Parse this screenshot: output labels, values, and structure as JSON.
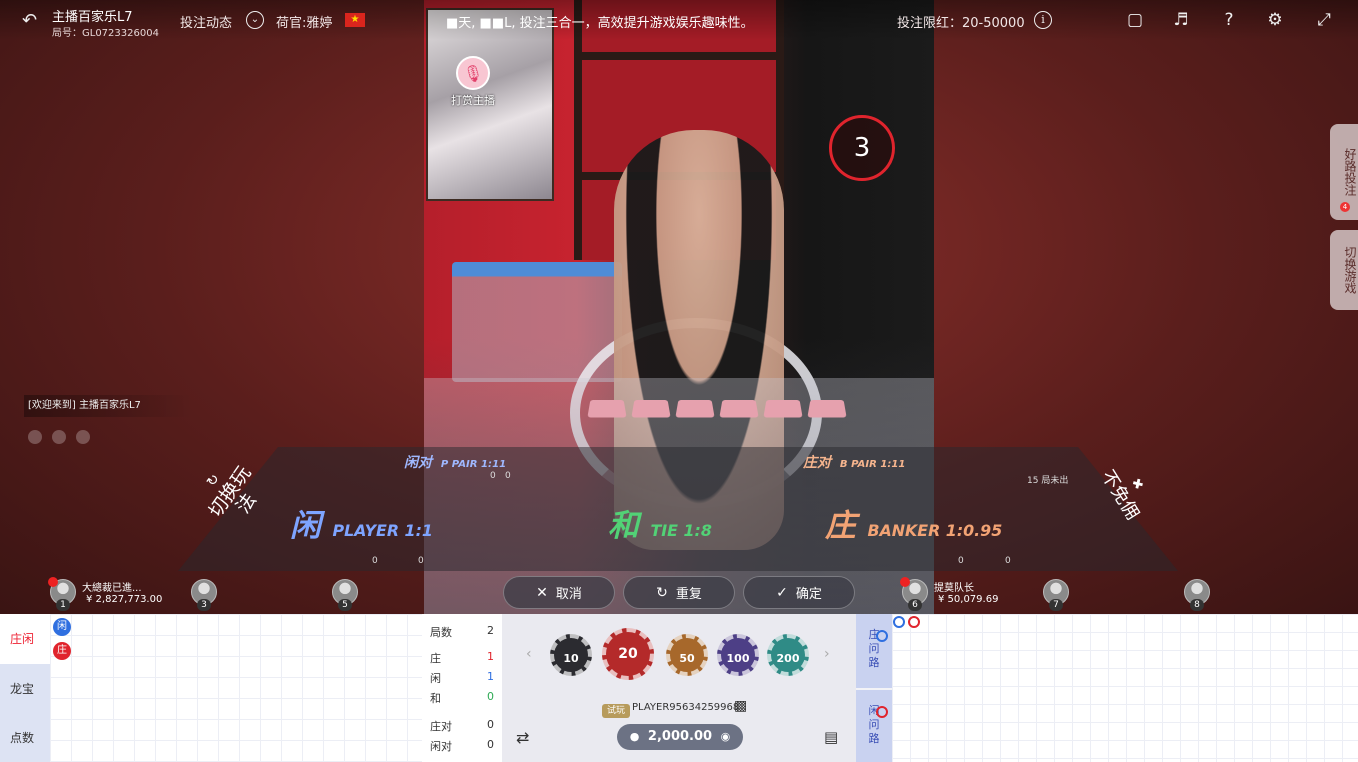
{
  "topbar": {
    "room_title": "主播百家乐L7",
    "round_id": "局号：GL0723326004",
    "bet_activity": "投注动态",
    "dealer_label": "荷官:雅婷",
    "marquee": "■天, ■■L, 投注三合一，高效提升游戏娱乐趣味性。",
    "bet_limit": "投注限红：20-50000",
    "icons": [
      "back-icon",
      "chevron-down-icon",
      "flag-icon",
      "info-icon",
      "camera-icon",
      "volume-icon",
      "help-icon",
      "settings-icon",
      "fullscreen-icon"
    ]
  },
  "video": {
    "tip_label": "打赏主播",
    "countdown": "3"
  },
  "side_tabs": {
    "good_road": "好路投注",
    "good_road_badge": "4",
    "switch_game": "切换游戏"
  },
  "chat": {
    "welcome": "[欢迎来到] 主播百家乐L7"
  },
  "table": {
    "switch_mode": "切换玩法",
    "no_commission": "不免佣",
    "p_pair_cn": "闲对",
    "p_pair_en": "P PAIR 1:11",
    "b_pair_cn": "庄对",
    "b_pair_en": "B PAIR 1:11",
    "player_cn": "闲",
    "player_en": "PLAYER 1:1",
    "tie_cn": "和",
    "tie_en": "TIE 1:8",
    "banker_cn": "庄",
    "banker_en": "BANKER 1:0.95",
    "zero": "0",
    "banker_side_note": "15 局未出"
  },
  "seats": [
    {
      "num": "1",
      "name": "大總裁已進...",
      "balance": "¥ 2,827,773.00"
    },
    {
      "num": "3",
      "name": "",
      "balance": ""
    },
    {
      "num": "5",
      "name": "",
      "balance": ""
    },
    {
      "num": "6",
      "name": "提莫队长",
      "balance": "¥ 50,079.69"
    },
    {
      "num": "7",
      "name": "",
      "balance": ""
    },
    {
      "num": "8",
      "name": "",
      "balance": ""
    }
  ],
  "actions": {
    "cancel": "取消",
    "repeat": "重复",
    "confirm": "确定"
  },
  "roads": {
    "tabs": [
      "庄闲",
      "龙宝",
      "点数"
    ],
    "bead_player": "闲",
    "bead_banker": "庄"
  },
  "stats": {
    "rounds_label": "局数",
    "rounds": "2",
    "banker_label": "庄",
    "banker": "1",
    "player_label": "闲",
    "player": "1",
    "tie_label": "和",
    "tie": "0",
    "bpair_label": "庄对",
    "bpair": "0",
    "ppair_label": "闲对",
    "ppair": "0"
  },
  "chips": {
    "values": [
      "10",
      "20",
      "50",
      "100",
      "200"
    ],
    "selected": "20",
    "colors": [
      "#2b2b30",
      "#b42a2a",
      "#a7682b",
      "#4d3f86",
      "#2f8b86"
    ]
  },
  "player": {
    "trial": "试玩",
    "id": "PLAYER95634259968",
    "balance": "2,000.00"
  },
  "ask": {
    "banker": "庄问路",
    "player": "闲问路"
  },
  "colors": {
    "player_blue": "#2f6fe0",
    "banker_red": "#e0242d",
    "tie_green": "#52d276"
  }
}
